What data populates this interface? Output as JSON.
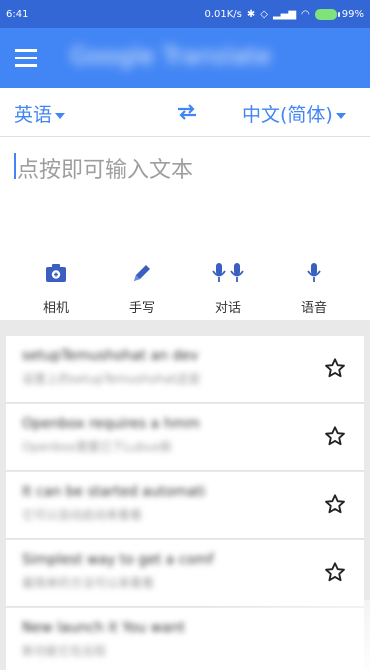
{
  "status_bar": {
    "time": "6:41",
    "network_speed": "0.01K/s",
    "battery": "99%"
  },
  "app_bar": {
    "title": "Google Translate"
  },
  "languages": {
    "source": "英语",
    "target": "中文(简体)"
  },
  "input": {
    "placeholder": "点按即可输入文本"
  },
  "tools": [
    {
      "label": "相机",
      "icon": "camera-icon"
    },
    {
      "label": "手写",
      "icon": "pen-icon"
    },
    {
      "label": "对话",
      "icon": "conversation-mic-icon"
    },
    {
      "label": "语音",
      "icon": "mic-icon"
    }
  ],
  "history": [
    {
      "line1": "setupTemushohat an dev",
      "line2": "设置上的setupTemushohat这是"
    },
    {
      "line1": "Openbox requires a hmm",
      "line2": "Openbox需要已下Lubux新"
    },
    {
      "line1": "It can be started automati",
      "line2": "它可以自动启动来看看"
    },
    {
      "line1": "Simplest way to get a comf",
      "line2": "最简单的方法可以来看看"
    },
    {
      "line1": "New launch it You want",
      "line2": "新功能它在出现"
    }
  ],
  "colors": {
    "brand_blue": "#4285f4",
    "status_blue": "#3367d6"
  }
}
